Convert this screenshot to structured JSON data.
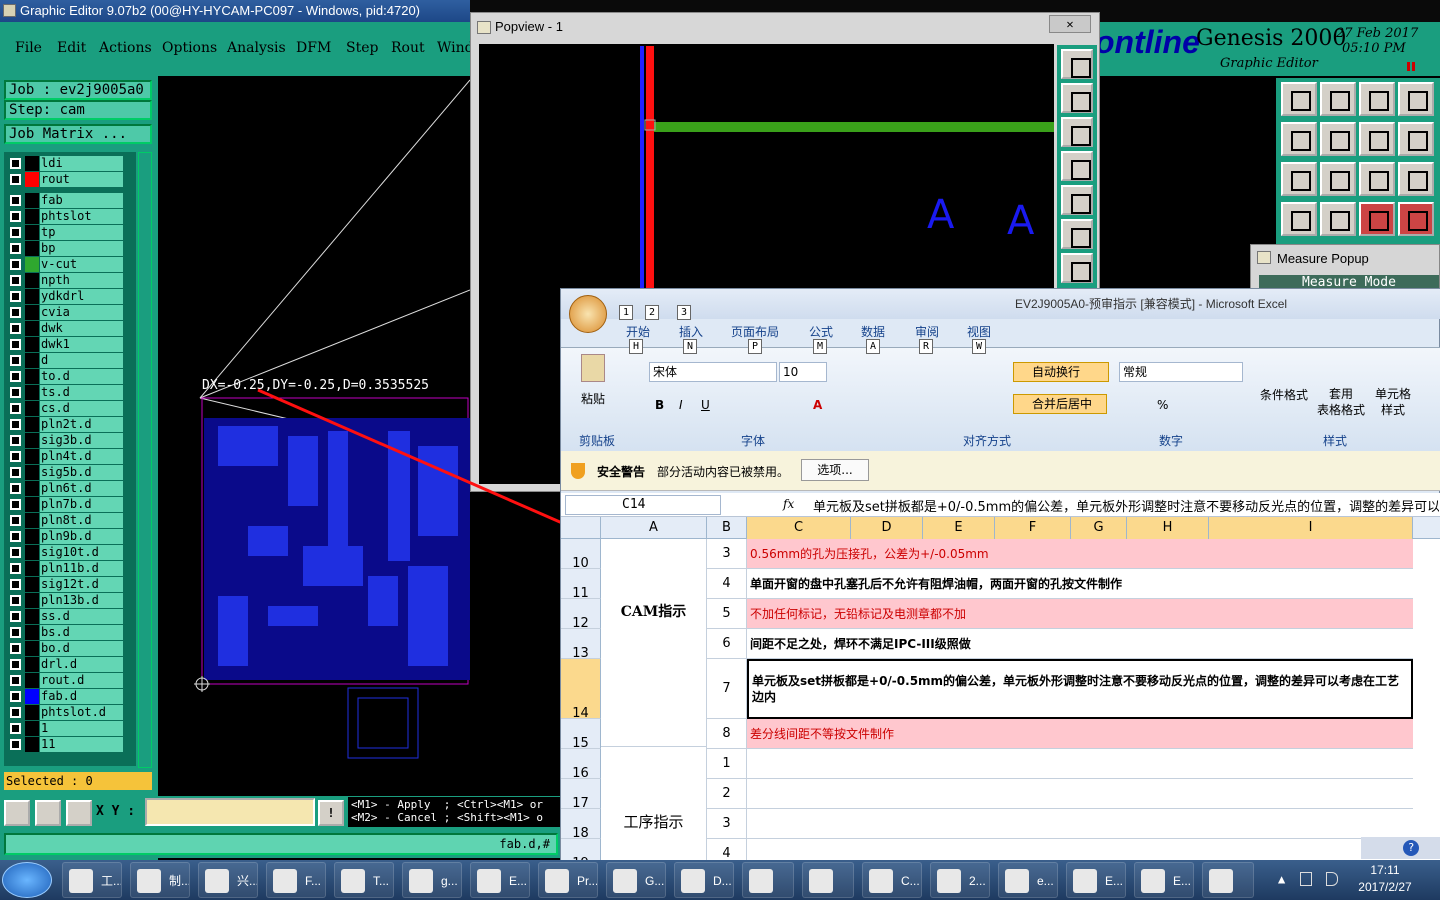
{
  "genesis": {
    "title": "Graphic Editor 9.07b2 (00@HY-HYCAM-PC097 - Windows, pid:4720)",
    "menu": [
      "File",
      "Edit",
      "Actions",
      "Options",
      "Analysis",
      "DFM",
      "Step",
      "Rout",
      "Wind"
    ],
    "job": "Job : ev2j9005a0",
    "step": "Step: cam",
    "job_matrix": "Job Matrix ...",
    "layers_top": [
      {
        "name": "ldi",
        "color": "#000000"
      },
      {
        "name": "rout",
        "color": "#ff0000"
      }
    ],
    "layers": [
      {
        "name": "fab",
        "color": "#000000"
      },
      {
        "name": "phtslot",
        "color": "#000000"
      },
      {
        "name": "tp",
        "color": "#000000"
      },
      {
        "name": "bp",
        "color": "#000000"
      },
      {
        "name": "v-cut",
        "color": "#2fa82f"
      },
      {
        "name": "npth",
        "color": "#000000"
      },
      {
        "name": "ydkdrl",
        "color": "#000000"
      },
      {
        "name": "cvia",
        "color": "#000000"
      },
      {
        "name": "dwk",
        "color": "#000000"
      },
      {
        "name": "dwk1",
        "color": "#000000"
      },
      {
        "name": "d",
        "color": "#000000"
      },
      {
        "name": "to.d",
        "color": "#000000"
      },
      {
        "name": "ts.d",
        "color": "#000000"
      },
      {
        "name": "cs.d",
        "color": "#000000"
      },
      {
        "name": "pln2t.d",
        "color": "#000000"
      },
      {
        "name": "sig3b.d",
        "color": "#000000"
      },
      {
        "name": "pln4t.d",
        "color": "#000000"
      },
      {
        "name": "sig5b.d",
        "color": "#000000"
      },
      {
        "name": "pln6t.d",
        "color": "#000000"
      },
      {
        "name": "pln7b.d",
        "color": "#000000"
      },
      {
        "name": "pln8t.d",
        "color": "#000000"
      },
      {
        "name": "pln9b.d",
        "color": "#000000"
      },
      {
        "name": "sig10t.d",
        "color": "#000000"
      },
      {
        "name": "pln11b.d",
        "color": "#000000"
      },
      {
        "name": "sig12t.d",
        "color": "#000000"
      },
      {
        "name": "pln13b.d",
        "color": "#000000"
      },
      {
        "name": "ss.d",
        "color": "#000000"
      },
      {
        "name": "bs.d",
        "color": "#000000"
      },
      {
        "name": "bo.d",
        "color": "#000000"
      },
      {
        "name": "drl.d",
        "color": "#000000"
      },
      {
        "name": "rout.d",
        "color": "#000000"
      },
      {
        "name": "fab.d",
        "color": "#0000ff"
      },
      {
        "name": "phtslot.d",
        "color": "#000000"
      },
      {
        "name": "1",
        "color": "#000000"
      },
      {
        "name": "11",
        "color": "#000000"
      }
    ],
    "selected": "Selected : 0",
    "xy_label": "X Y :",
    "help_text": "<M1> - Apply  ; <Ctrl><M1> or\n<M2> - Cancel ; <Shift><M1> o",
    "status": "fab.d,#",
    "measure_readout": "DX=-0.25,DY=-0.25,D=0.3535525",
    "brand": {
      "frontline": "ontline",
      "genesis": "Genesis 2000",
      "sub": "Graphic Editor",
      "date": "27 Feb 2017",
      "time": "05:10 PM"
    }
  },
  "popview": {
    "title": "Popview - 1",
    "close": "✕",
    "glyphs": [
      "A",
      "A"
    ]
  },
  "measure": {
    "title": "Measure Popup",
    "mode": "Measure Mode"
  },
  "excel": {
    "title": "EV2J9005A0-预审指示 [兼容模式] - Microsoft Excel",
    "qat_keys": [
      "1",
      "2",
      "3"
    ],
    "tabs": [
      {
        "label": "开始",
        "key": "H"
      },
      {
        "label": "插入",
        "key": "N"
      },
      {
        "label": "页面布局",
        "key": "P"
      },
      {
        "label": "公式",
        "key": "M"
      },
      {
        "label": "数据",
        "key": "A"
      },
      {
        "label": "审阅",
        "key": "R"
      },
      {
        "label": "视图",
        "key": "W"
      }
    ],
    "paste": "粘贴",
    "font_name": "宋体",
    "font_size": "10",
    "wrap_text": "自动换行",
    "merge_center": "合并后居中",
    "number_format": "常规",
    "cond_format": "条件格式",
    "table_format": "套用\n表格格式",
    "cell_style": "单元格\n样式",
    "groups": [
      "剪贴板",
      "字体",
      "对齐方式",
      "数字",
      "样式"
    ],
    "security_label": "安全警告",
    "security_msg": "部分活动内容已被禁用。",
    "options_btn": "选项...",
    "name_box": "C14",
    "fx": "fx",
    "formula": "单元板及set拼板都是+0/-0.5mm的偏公差，单元板外形调整时注意不要移动反光点的位置，调整的差异可以考虑在工艺边内",
    "columns": [
      "A",
      "B",
      "C",
      "D",
      "E",
      "F",
      "G",
      "H",
      "I"
    ],
    "rows": [
      {
        "row": "10",
        "b": "3",
        "c": "0.56mm的孔为压接孔，公差为+/-0.05mm",
        "pink": true
      },
      {
        "row": "11",
        "b": "4",
        "c": "单面开窗的盘中孔塞孔后不允许有阻焊油帽，两面开窗的孔按文件制作",
        "pink": false
      },
      {
        "row": "12",
        "b": "5",
        "c": "不加任何标记，无铅标记及电测章都不加",
        "pink": true
      },
      {
        "row": "13",
        "b": "6",
        "c": "间距不足之处，焊环不满足IPC-III级照做",
        "pink": false
      },
      {
        "row": "14",
        "b": "7",
        "c": "单元板及set拼板都是+0/-0.5mm的偏公差，单元板外形调整时注意不要移动反光点的位置，调整的差异可以考虑在工艺边内",
        "pink": false
      },
      {
        "row": "15",
        "b": "8",
        "c": "差分线间距不等按文件制作",
        "pink": true
      },
      {
        "row": "16",
        "b": "1",
        "c": "",
        "pink": false
      },
      {
        "row": "17",
        "b": "2",
        "c": "",
        "pink": false
      },
      {
        "row": "18",
        "b": "3",
        "c": "",
        "pink": false
      },
      {
        "row": "19",
        "b": "4",
        "c": "",
        "pink": false
      }
    ],
    "cam_label": "CAM指示",
    "process_label": "工序指示"
  },
  "taskbar": {
    "items": [
      "工...",
      "制...",
      "兴...",
      "F...",
      "T...",
      "g...",
      "E...",
      "Pr...",
      "G...",
      "D...",
      "",
      "",
      "C...",
      "2...",
      "e...",
      "E...",
      "E...",
      ""
    ],
    "time": "17:11",
    "date": "2017/2/27"
  }
}
